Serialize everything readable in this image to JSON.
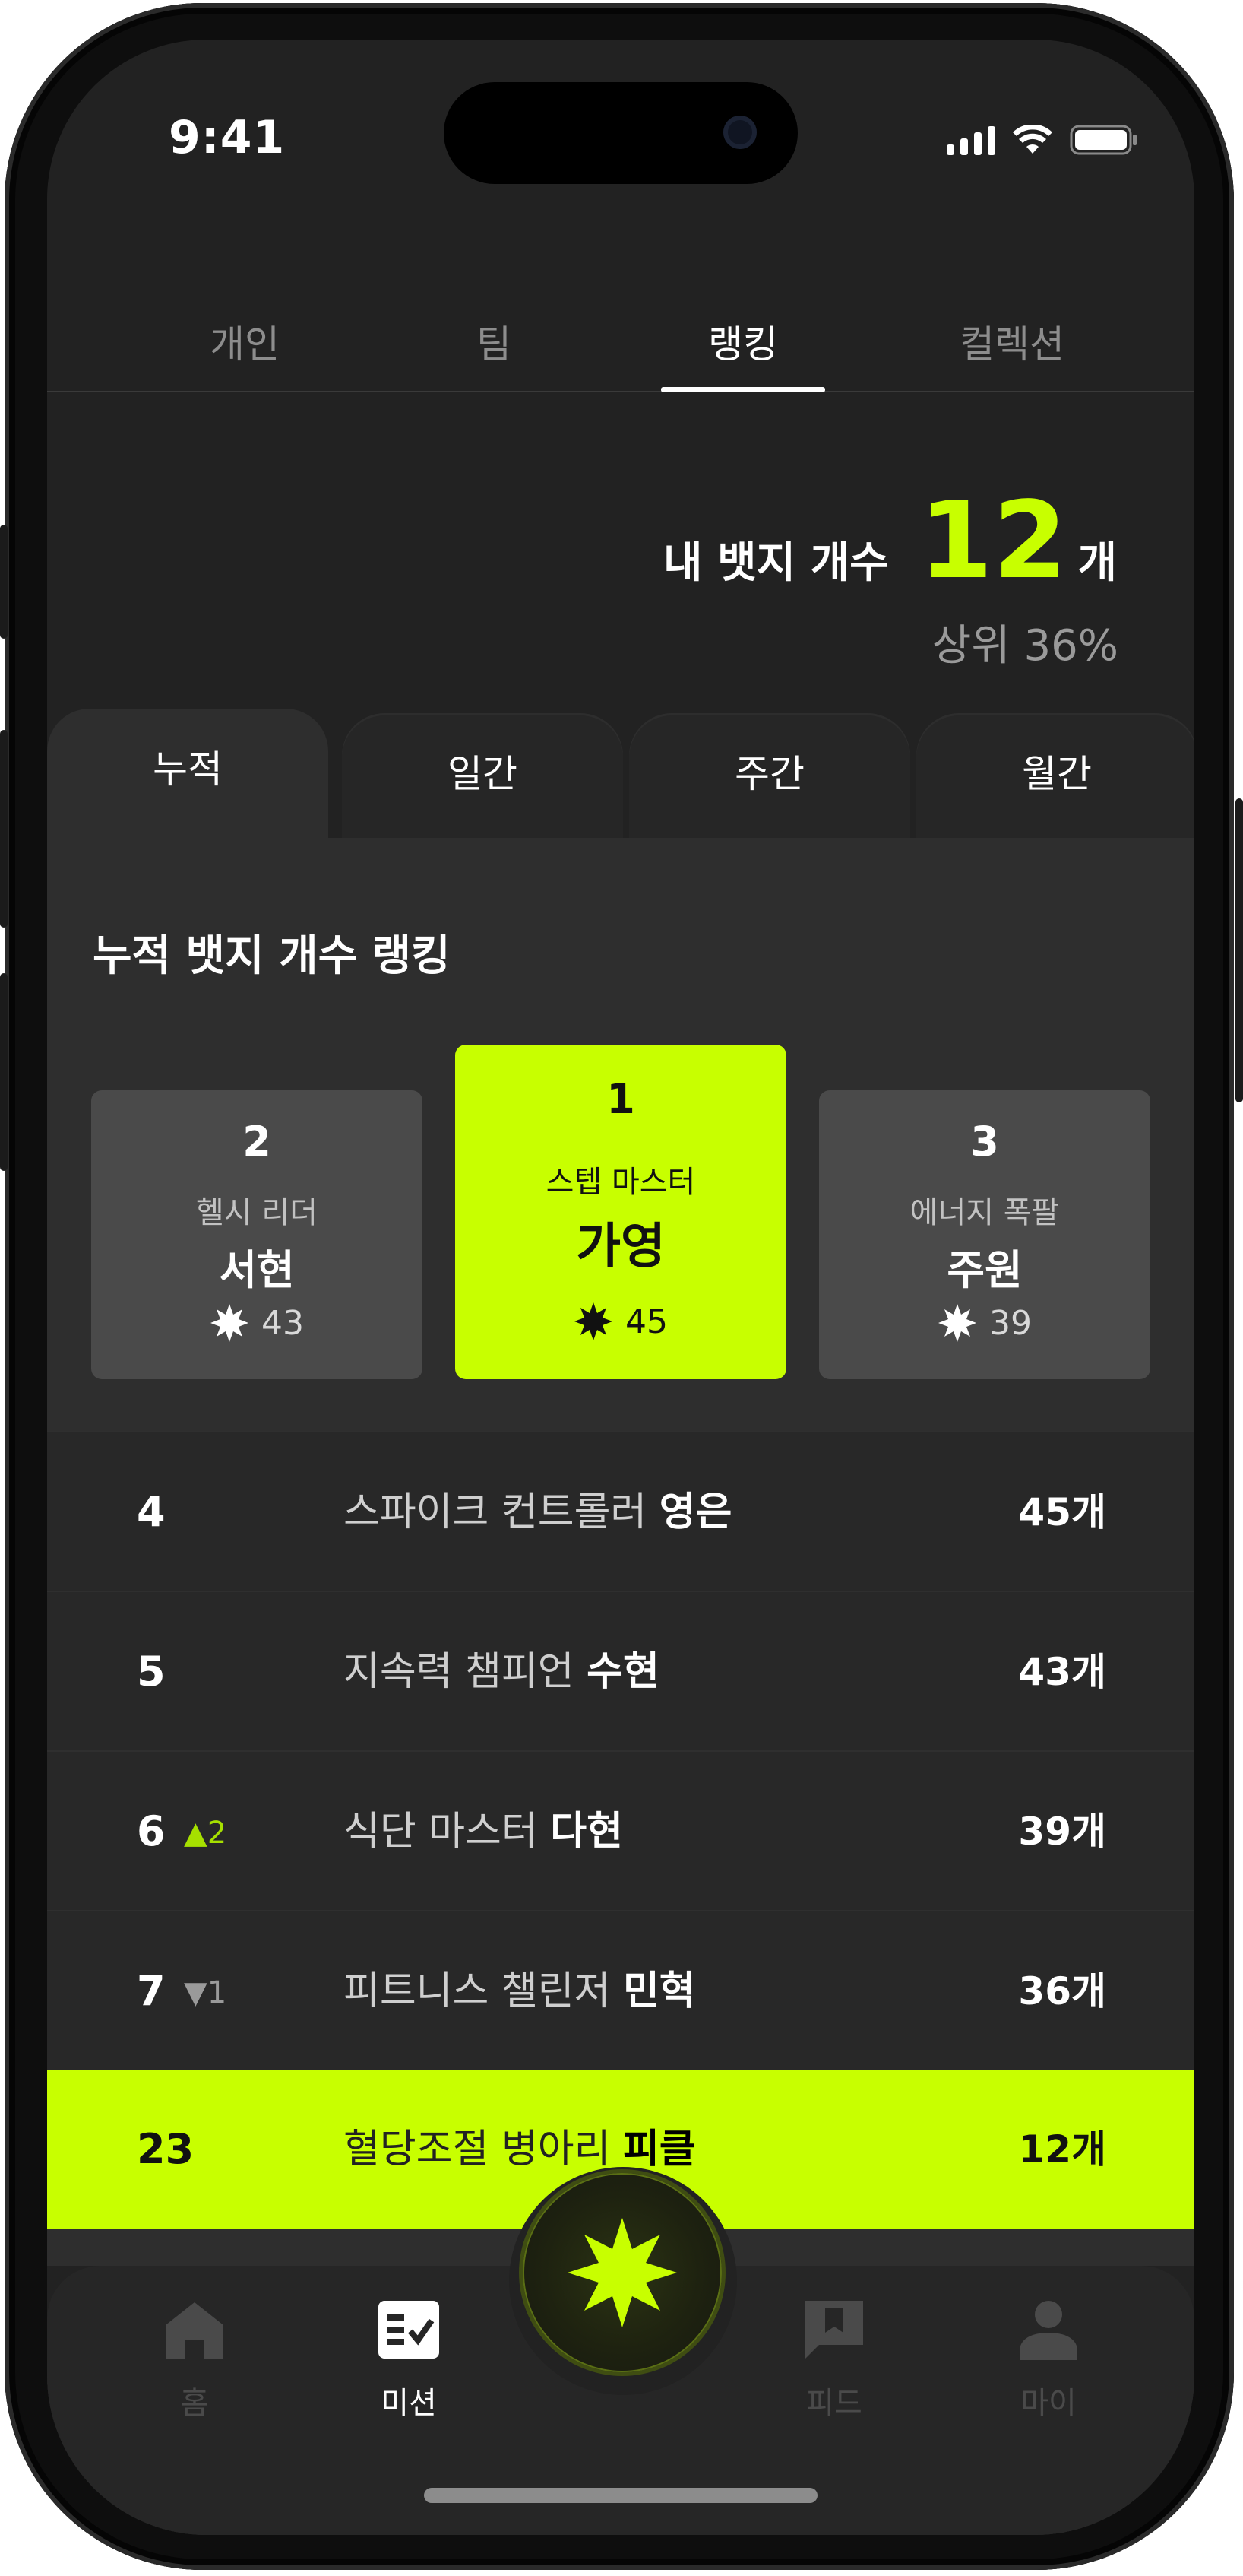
{
  "status_bar": {
    "time": "9:41"
  },
  "top_tabs": [
    {
      "label": "개인",
      "active": false
    },
    {
      "label": "팀",
      "active": false
    },
    {
      "label": "랭킹",
      "active": true
    },
    {
      "label": "컬렉션",
      "active": false
    }
  ],
  "my_badge": {
    "label": "내 뱃지 개수",
    "count": "12",
    "unit": "개",
    "rank_text": "상위 36%"
  },
  "period_tabs": [
    {
      "label": "누적",
      "active": true
    },
    {
      "label": "일간",
      "active": false
    },
    {
      "label": "주간",
      "active": false
    },
    {
      "label": "월간",
      "active": false
    }
  ],
  "ranking": {
    "title": "누적 뱃지 개수 랭킹",
    "podium": [
      {
        "position": "2",
        "subtitle": "헬시 리더",
        "name": "서현",
        "score": "43"
      },
      {
        "position": "1",
        "subtitle": "스텝 마스터",
        "name": "가영",
        "score": "45"
      },
      {
        "position": "3",
        "subtitle": "에너지 폭팔",
        "name": "주원",
        "score": "39"
      }
    ],
    "list": [
      {
        "rank": "4",
        "delta": "",
        "title_prefix": "스파이크 컨트롤러",
        "name": "영은",
        "count": "45개"
      },
      {
        "rank": "5",
        "delta": "",
        "title_prefix": "지속력 챔피언",
        "name": "수현",
        "count": "43개"
      },
      {
        "rank": "6",
        "delta": "▲2",
        "title_prefix": "식단 마스터",
        "name": "다현",
        "count": "39개"
      },
      {
        "rank": "7",
        "delta": "▼1",
        "title_prefix": "피트니스 챌린저",
        "name": "민혁",
        "count": "36개"
      }
    ],
    "me": {
      "rank": "23",
      "title_prefix": "혈당조절 병아리",
      "name": "피클",
      "count": "12개"
    }
  },
  "bottom_nav": [
    {
      "label": "홈",
      "icon": "home-icon",
      "active": false
    },
    {
      "label": "미션",
      "icon": "mission-checklist-icon",
      "active": true
    },
    {
      "label": "피드",
      "icon": "feed-bookmark-icon",
      "active": false
    },
    {
      "label": "마이",
      "icon": "profile-icon",
      "active": false
    }
  ],
  "colors": {
    "accent": "#c8ff00",
    "background": "#222222",
    "panel": "#2e2e2e"
  }
}
